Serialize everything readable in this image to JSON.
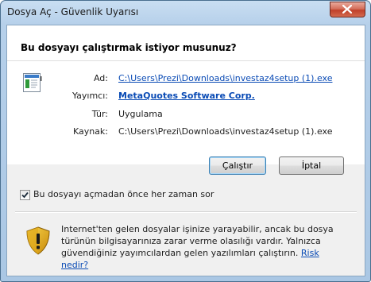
{
  "window": {
    "title": "Dosya Aç - Güvenlik Uyarısı",
    "close_icon": "close-icon"
  },
  "header": {
    "question": "Bu dosyayı çalıştırmak istiyor musunuz?"
  },
  "file_info": {
    "icon": "executable-file-icon",
    "name_label": "Ad:",
    "name_value": "C:\\Users\\Prezi\\Downloads\\investaz4setup (1).exe",
    "publisher_label": "Yayımcı:",
    "publisher_value": "MetaQuotes Software Corp.",
    "type_label": "Tür:",
    "type_value": "Uygulama",
    "source_label": "Kaynak:",
    "source_value": "C:\\Users\\Prezi\\Downloads\\investaz4setup (1).exe"
  },
  "buttons": {
    "run_label": "Çalıştır",
    "cancel_label": "İptal"
  },
  "checkbox": {
    "label": "Bu dosyayı açmadan önce her zaman sor",
    "checked": true
  },
  "warning": {
    "icon": "shield-warning-icon",
    "text": "Internet'ten gelen dosyalar işinize yarayabilir, ancak bu dosya türünün bilgisayarınıza zarar verme olasılığı vardır. Yalnızca güvendiğiniz yayımcılardan gelen yazılımları çalıştırın.",
    "risk_link": "Risk nedir?"
  },
  "colors": {
    "link": "#0a4bb5",
    "titlebar": "#b6d0ea",
    "close": "#c0402a"
  }
}
